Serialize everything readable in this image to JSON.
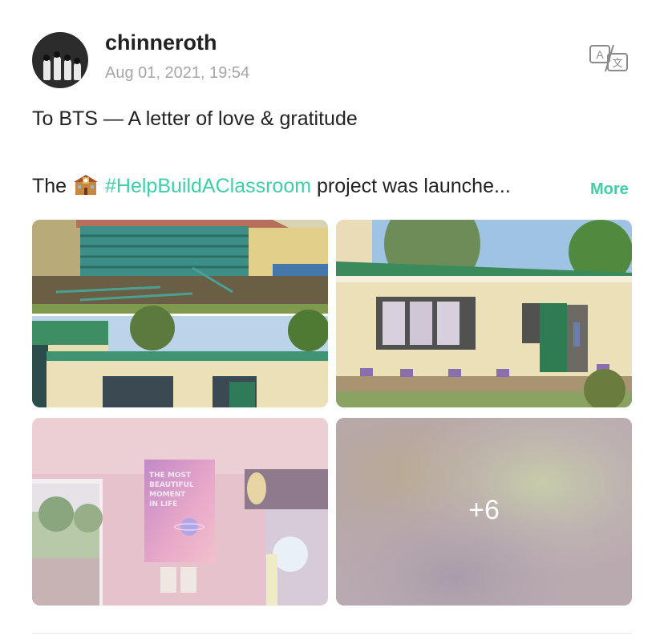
{
  "post": {
    "username": "chinneroth",
    "timestamp": "Aug 01, 2021, 19:54",
    "title": "To BTS — A letter of love & gratitude",
    "body_before": "The",
    "hashtag": "#HelpBuildAClassroom",
    "body_after": "project was launche...",
    "more_label": "More"
  },
  "gallery": {
    "more_count": "+6",
    "poster_text": "THE MOST BEAUTIFUL MOMENT IN LIFE"
  },
  "icons": {
    "translate": "translate-icon",
    "school_emoji": "school-icon"
  },
  "colors": {
    "accent": "#3ecfa9",
    "timestamp": "#a6a6a6",
    "text": "#222222"
  }
}
